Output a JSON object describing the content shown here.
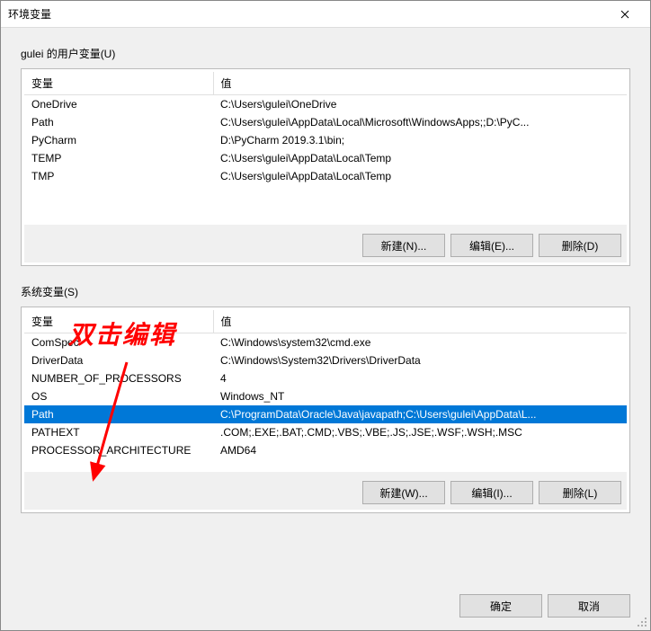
{
  "window": {
    "title": "环境变量"
  },
  "userSection": {
    "label": "gulei 的用户变量(U)",
    "headers": {
      "var": "变量",
      "val": "值"
    },
    "rows": [
      {
        "var": "OneDrive",
        "val": "C:\\Users\\gulei\\OneDrive"
      },
      {
        "var": "Path",
        "val": "C:\\Users\\gulei\\AppData\\Local\\Microsoft\\WindowsApps;;D:\\PyC..."
      },
      {
        "var": "PyCharm",
        "val": "D:\\PyCharm 2019.3.1\\bin;"
      },
      {
        "var": "TEMP",
        "val": "C:\\Users\\gulei\\AppData\\Local\\Temp"
      },
      {
        "var": "TMP",
        "val": "C:\\Users\\gulei\\AppData\\Local\\Temp"
      }
    ],
    "buttons": {
      "new": "新建(N)...",
      "edit": "编辑(E)...",
      "delete": "删除(D)"
    }
  },
  "systemSection": {
    "label": "系统变量(S)",
    "headers": {
      "var": "变量",
      "val": "值"
    },
    "rows": [
      {
        "var": "ComSpec",
        "val": "C:\\Windows\\system32\\cmd.exe"
      },
      {
        "var": "DriverData",
        "val": "C:\\Windows\\System32\\Drivers\\DriverData"
      },
      {
        "var": "NUMBER_OF_PROCESSORS",
        "val": "4"
      },
      {
        "var": "OS",
        "val": "Windows_NT"
      },
      {
        "var": "Path",
        "val": "C:\\ProgramData\\Oracle\\Java\\javapath;C:\\Users\\gulei\\AppData\\L...",
        "selected": true
      },
      {
        "var": "PATHEXT",
        "val": ".COM;.EXE;.BAT;.CMD;.VBS;.VBE;.JS;.JSE;.WSF;.WSH;.MSC"
      },
      {
        "var": "PROCESSOR_ARCHITECTURE",
        "val": "AMD64"
      }
    ],
    "buttons": {
      "new": "新建(W)...",
      "edit": "编辑(I)...",
      "delete": "删除(L)"
    }
  },
  "dialogButtons": {
    "ok": "确定",
    "cancel": "取消"
  },
  "annotation": {
    "text": "双击编辑"
  }
}
